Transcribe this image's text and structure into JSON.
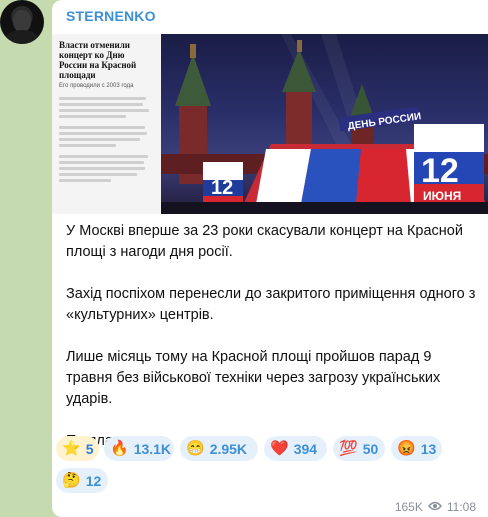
{
  "channel": {
    "author": "STERNENKO"
  },
  "media": {
    "headline": "Власти отменили концерт ко Дню России на Красной площади",
    "subheadline": "Его проводили с 2003 года",
    "banner_text": "ДЕНЬ РОССИИ",
    "date_day": "12",
    "date_month": "ИЮНЯ"
  },
  "message": {
    "paragraphs": [
      "У Москві вперше за 23 роки скасували концерт на Красной площі з нагоди дня росії.",
      "Захід поспіхом перенесли до закритого приміщення одного з «культурних» центрів.",
      "Лише місяць тому на Красной площі пройшов парад 9 травня без військової техніки через загрозу українських ударів.",
      "По плану"
    ]
  },
  "reactions": [
    {
      "emoji": "⭐",
      "count": "5",
      "icon": "star-icon"
    },
    {
      "emoji": "🔥",
      "count": "13.1K",
      "icon": "fire-icon"
    },
    {
      "emoji": "😁",
      "count": "2.95K",
      "icon": "grin-icon"
    },
    {
      "emoji": "❤️",
      "count": "394",
      "icon": "heart-icon"
    },
    {
      "emoji": "💯",
      "count": "50",
      "icon": "hundred-icon"
    },
    {
      "emoji": "😡",
      "count": "13",
      "icon": "angry-icon"
    },
    {
      "emoji": "🤔",
      "count": "12",
      "icon": "thinking-icon"
    }
  ],
  "meta": {
    "views": "165K",
    "time": "11:08"
  },
  "colors": {
    "background": "#c6dab0",
    "bubble": "#ffffff",
    "accent": "#3d8fd6",
    "reaction_bg": "#e6f0fb"
  }
}
